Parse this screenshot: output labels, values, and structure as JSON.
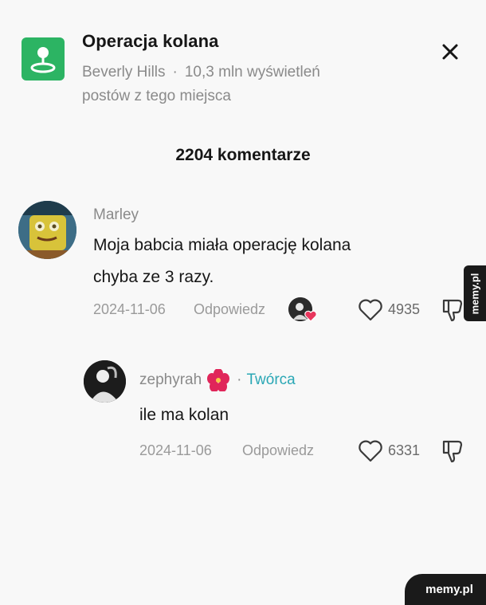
{
  "location": {
    "title": "Operacja kolana",
    "place": "Beverly Hills",
    "views": "10,3 mln wyświetleń",
    "views_line2": "postów z tego miejsca",
    "separator": "·"
  },
  "comments_header": "2204 komentarze",
  "comments": [
    {
      "username": "Marley",
      "text_line1": "Moja babcia miała operację kolana",
      "text_line2": "chyba ze 3 razy.",
      "date": "2024-11-06",
      "reply_label": "Odpowiedz",
      "likes": "4935"
    }
  ],
  "replies": [
    {
      "username": "zephyrah",
      "creator_label": "Twórca",
      "separator": "·",
      "text": "ile ma kolan",
      "date": "2024-11-06",
      "reply_label": "Odpowiedz",
      "likes": "6331"
    }
  ],
  "watermark": "memy.pl",
  "colors": {
    "location_icon_bg": "#2cb463",
    "creator_tag": "#2aa7b5",
    "heart_badge": "#e8365d"
  },
  "icons": [
    "location-pin-icon",
    "close-icon",
    "heart-icon",
    "dislike-icon",
    "heart-badge-icon"
  ]
}
